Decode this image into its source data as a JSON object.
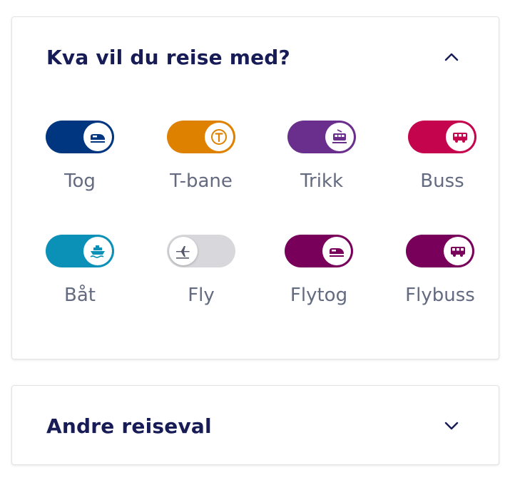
{
  "panel1": {
    "title": "Kva vil du reise med?",
    "expanded": true,
    "chevron_icon": "chevron-up-icon",
    "modes": [
      {
        "key": "tog",
        "label": "Tog",
        "on": true,
        "color": "#00367f",
        "icon": "train-icon"
      },
      {
        "key": "tbane",
        "label": "T-bane",
        "on": true,
        "color": "#df8100",
        "icon": "metro-icon"
      },
      {
        "key": "trikk",
        "label": "Trikk",
        "on": true,
        "color": "#6a2f8c",
        "icon": "tram-icon"
      },
      {
        "key": "buss",
        "label": "Buss",
        "on": true,
        "color": "#c5044e",
        "icon": "bus-icon"
      },
      {
        "key": "bat",
        "label": "Båt",
        "on": true,
        "color": "#0b91b7",
        "icon": "ferry-icon"
      },
      {
        "key": "fly",
        "label": "Fly",
        "on": false,
        "color": "#d8d8dc",
        "icon": "plane-icon"
      },
      {
        "key": "flytog",
        "label": "Flytog",
        "on": true,
        "color": "#78005a",
        "icon": "airport-train-icon"
      },
      {
        "key": "flybuss",
        "label": "Flybuss",
        "on": true,
        "color": "#78005a",
        "icon": "airport-bus-icon"
      }
    ]
  },
  "panel2": {
    "title": "Andre reiseval",
    "expanded": false,
    "chevron_icon": "chevron-down-icon"
  },
  "colors": {
    "title": "#181c56",
    "label": "#646a80"
  }
}
